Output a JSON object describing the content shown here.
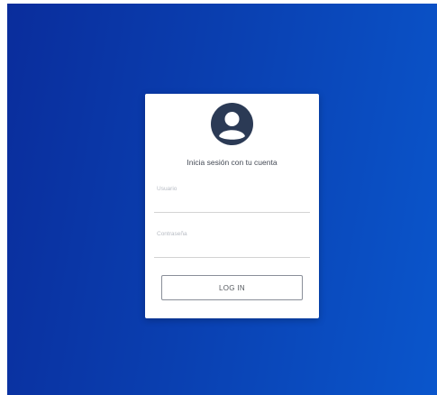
{
  "login": {
    "heading": "Inicia sesión con tu cuenta",
    "username_label": "Usuario",
    "password_label": "Contraseña",
    "username_value": "",
    "password_value": "",
    "submit_label": "LOG IN"
  },
  "icons": {
    "avatar": "user-circle-icon"
  },
  "colors": {
    "background_gradient_start": "#0a2d9c",
    "background_gradient_end": "#0a56cc",
    "avatar": "#2b3a55",
    "card": "#ffffff"
  }
}
